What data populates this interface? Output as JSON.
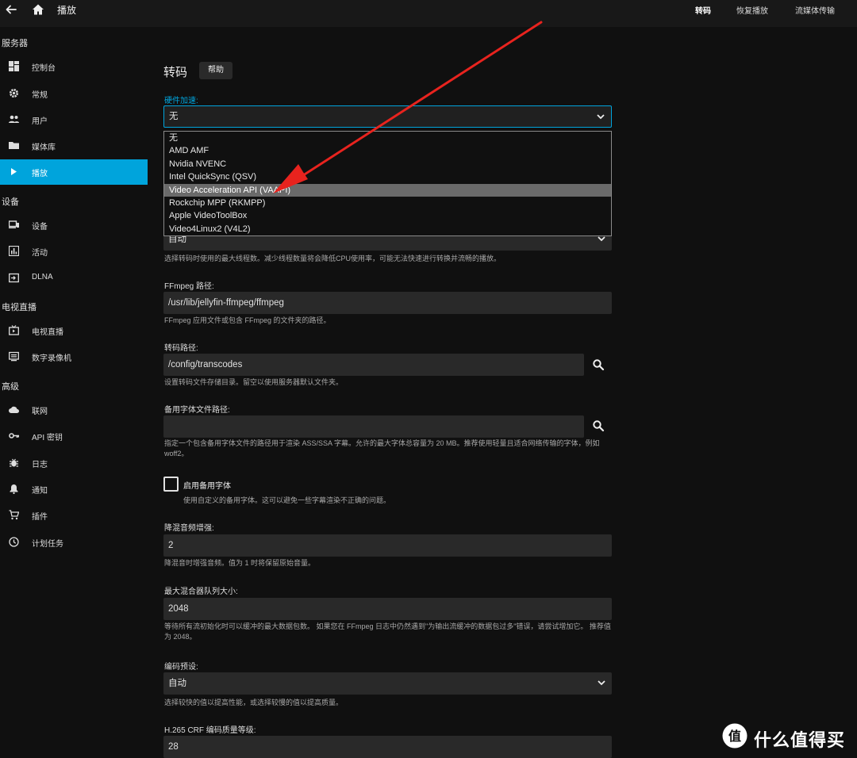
{
  "topbar": {
    "title": "播放",
    "tabs": [
      {
        "label": "转码",
        "active": true
      },
      {
        "label": "恢复播放",
        "active": false
      },
      {
        "label": "流媒体传输",
        "active": false
      }
    ]
  },
  "sidebar": {
    "sections": [
      {
        "title": "服务器",
        "items": [
          {
            "label": "控制台",
            "icon": "dashboard-icon"
          },
          {
            "label": "常规",
            "icon": "gear-icon"
          },
          {
            "label": "用户",
            "icon": "users-icon"
          },
          {
            "label": "媒体库",
            "icon": "folder-icon"
          },
          {
            "label": "播放",
            "icon": "play-icon",
            "active": true
          }
        ]
      },
      {
        "title": "设备",
        "items": [
          {
            "label": "设备",
            "icon": "devices-icon"
          },
          {
            "label": "活动",
            "icon": "activity-icon"
          },
          {
            "label": "DLNA",
            "icon": "input-icon"
          }
        ]
      },
      {
        "title": "电视直播",
        "items": [
          {
            "label": "电视直播",
            "icon": "live-tv-icon"
          },
          {
            "label": "数字录像机",
            "icon": "dvr-icon"
          }
        ]
      },
      {
        "title": "高级",
        "items": [
          {
            "label": "联网",
            "icon": "cloud-icon"
          },
          {
            "label": "API 密钥",
            "icon": "key-icon"
          },
          {
            "label": "日志",
            "icon": "bug-icon"
          },
          {
            "label": "通知",
            "icon": "bell-icon"
          },
          {
            "label": "插件",
            "icon": "cart-icon"
          },
          {
            "label": "计划任务",
            "icon": "clock-icon"
          }
        ]
      }
    ]
  },
  "main": {
    "title": "转码",
    "help_label": "帮助",
    "hw_accel": {
      "label": "硬件加速:",
      "value": "无",
      "options": [
        {
          "label": "无"
        },
        {
          "label": "AMD AMF"
        },
        {
          "label": "Nvidia NVENC"
        },
        {
          "label": "Intel QuickSync (QSV)"
        },
        {
          "label": "Video Acceleration API (VAAPI)",
          "highlighted": true
        },
        {
          "label": "Rockchip MPP (RKMPP)"
        },
        {
          "label": "Apple VideoToolBox"
        },
        {
          "label": "Video4Linux2 (V4L2)"
        }
      ]
    },
    "threads": {
      "value": "自动",
      "desc": "选择转码时使用的最大线程数。减少线程数量将会降低CPU使用率，可能无法快速进行转换并流畅的播放。"
    },
    "ffmpeg_path": {
      "label": "FFmpeg 路径:",
      "value": "/usr/lib/jellyfin-ffmpeg/ffmpeg",
      "desc": "FFmpeg 应用文件或包含 FFmpeg 的文件夹的路径。"
    },
    "transcode_path": {
      "label": "转码路径:",
      "value": "/config/transcodes",
      "desc": "设置转码文件存储目录。留空以使用服务器默认文件夹。"
    },
    "fallback_font_path": {
      "label": "备用字体文件路径:",
      "value": "",
      "desc": "指定一个包含备用字体文件的路径用于渲染 ASS/SSA 字幕。允许的最大字体总容量为 20 MB。推荐使用轻量且适合网络传输的字体，例如 woff2。"
    },
    "enable_fallback_font": {
      "label": "启用备用字体",
      "checked": false,
      "desc": "使用自定义的备用字体。这可以避免一些字幕渲染不正确的问题。"
    },
    "downmix_boost": {
      "label": "降混音频增强:",
      "value": "2",
      "desc": "降混音时增强音频。值为 1 时将保留原始音量。"
    },
    "max_muxing_queue": {
      "label": "最大混合器队列大小:",
      "value": "2048",
      "desc": "等待所有流初始化时可以缓冲的最大数据包数。 如果您在 FFmpeg 日志中仍然遇到\"为输出流缓冲的数据包过多\"错误，请尝试增加它。 推荐值为 2048。"
    },
    "encoder_preset": {
      "label": "编码预设:",
      "value": "自动",
      "desc": "选择较快的值以提高性能，或选择较慢的值以提高质量。"
    },
    "h265_crf": {
      "label": "H.265 CRF 编码质量等级:",
      "value": "28"
    }
  },
  "watermark": {
    "text": "什么值得买",
    "logo_text": "值"
  },
  "colors": {
    "accent": "#00a4dc",
    "arrow": "#e8231e"
  }
}
